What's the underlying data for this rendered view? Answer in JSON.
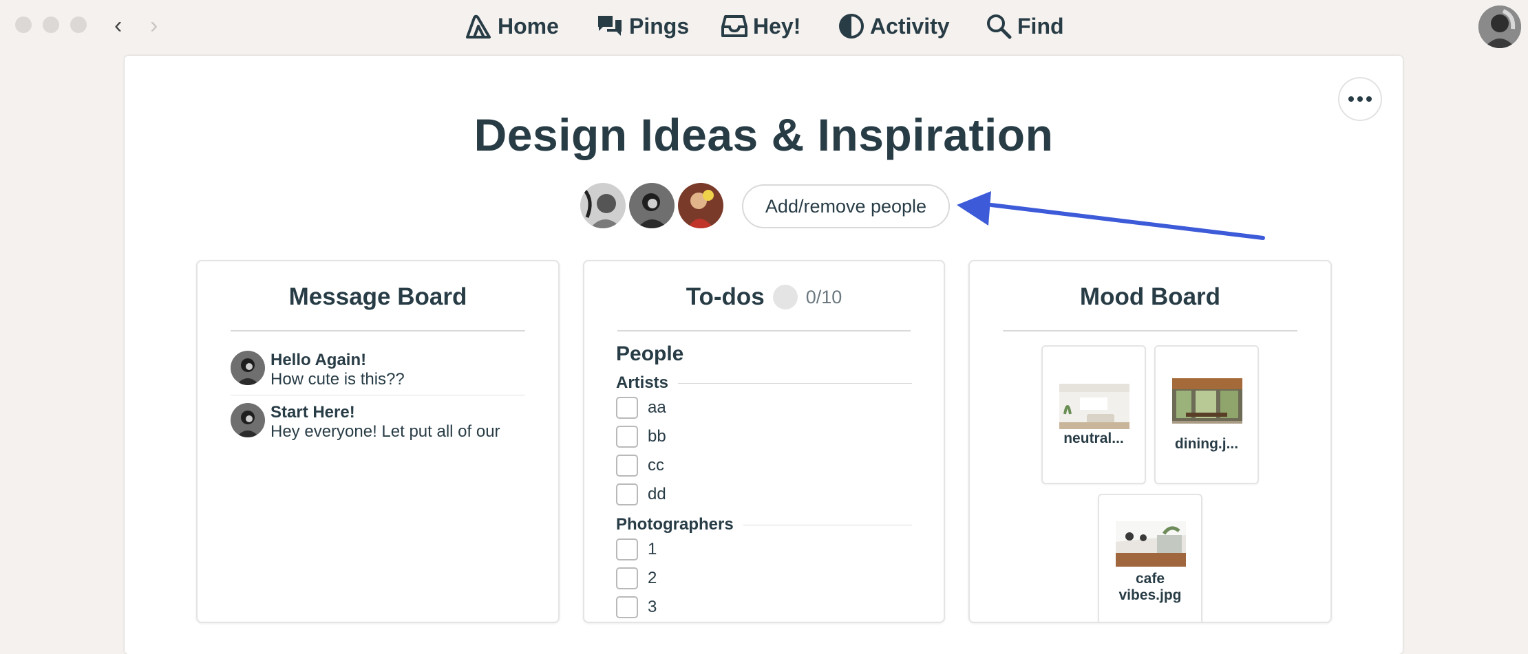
{
  "nav": {
    "home": "Home",
    "pings": "Pings",
    "hey": "Hey!",
    "activity": "Activity",
    "find": "Find"
  },
  "project": {
    "title": "Design Ideas & Inspiration",
    "add_people_label": "Add/remove people"
  },
  "message_board": {
    "title": "Message Board",
    "messages": [
      {
        "subject": "Hello Again!",
        "excerpt": "How cute is this??"
      },
      {
        "subject": "Start Here!",
        "excerpt": "Hey everyone! Let put all of our"
      }
    ]
  },
  "todos": {
    "title": "To-dos",
    "progress": "0/10",
    "list_title": "People",
    "groups": [
      {
        "name": "Artists",
        "items": [
          "aa",
          "bb",
          "cc",
          "dd"
        ]
      },
      {
        "name": "Photographers",
        "items": [
          "1",
          "2",
          "3"
        ]
      }
    ]
  },
  "mood_board": {
    "title": "Mood Board",
    "files": [
      {
        "name": "neutral..."
      },
      {
        "name": "dining.j..."
      },
      {
        "name": "cafe vibes.jpg",
        "line1": "cafe",
        "line2": "vibes.jpg"
      }
    ]
  },
  "colors": {
    "text": "#283c46",
    "background": "#f4f1ee",
    "annotation_arrow": "#3d5bd9"
  }
}
